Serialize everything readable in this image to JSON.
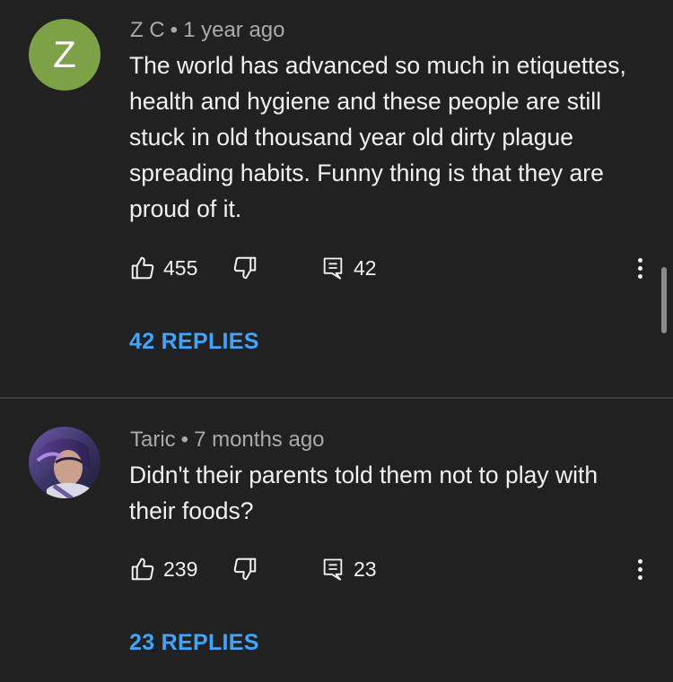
{
  "comments": [
    {
      "avatar_letter": "Z",
      "author": "Z C",
      "separator": "•",
      "time": "1 year ago",
      "text": "The world has advanced so much in etiquettes, health and hygiene and these people are still stuck in old thousand year old dirty plague spreading habits. Funny thing is that they are proud of it.",
      "likes": "455",
      "reply_count": "42",
      "replies_label": "42 REPLIES"
    },
    {
      "author": "Taric",
      "separator": "•",
      "time": "7 months ago",
      "text": "Didn't their parents told them not to play with their foods?",
      "likes": "239",
      "reply_count": "23",
      "replies_label": "23 REPLIES"
    }
  ],
  "colors": {
    "background": "#212121",
    "link": "#3ea6ff",
    "avatar_z": "#7ca146",
    "meta": "#aaaaaa"
  },
  "icons": [
    "thumbs-up-icon",
    "thumbs-down-icon",
    "reply-icon",
    "more-vert-icon"
  ]
}
